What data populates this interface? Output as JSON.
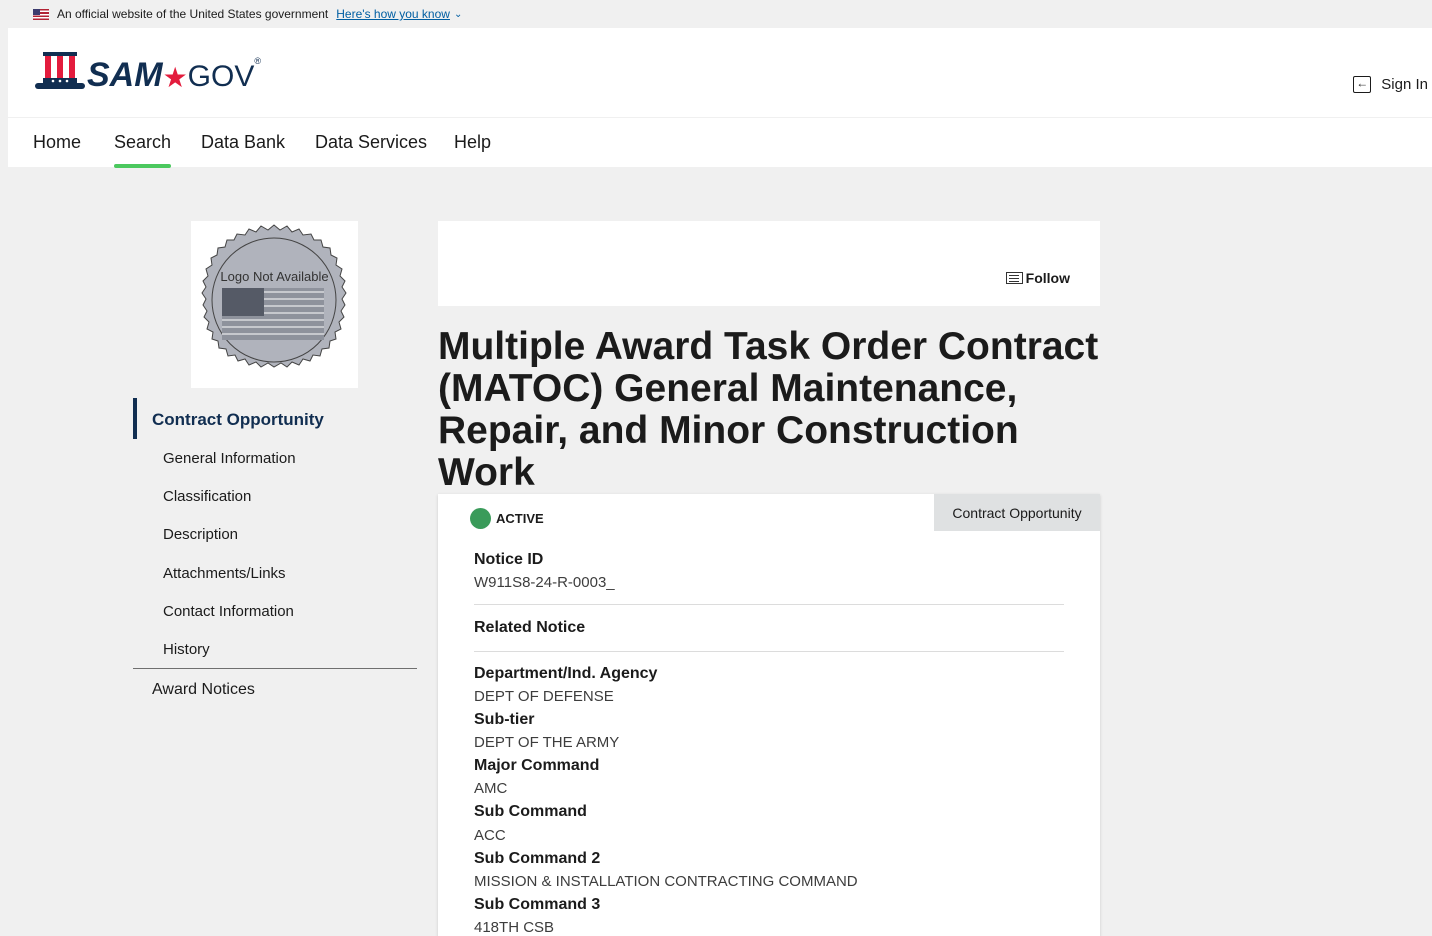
{
  "gov_banner": {
    "text": "An official website of the United States government",
    "link": "Here's how you know"
  },
  "header": {
    "logo_sam": "SAM",
    "logo_dot": "★",
    "logo_gov": "GOV",
    "logo_reg": "®",
    "sign_in": "Sign In"
  },
  "nav": {
    "items": [
      {
        "label": "Home"
      },
      {
        "label": "Search",
        "active": true
      },
      {
        "label": "Data Bank"
      },
      {
        "label": "Data Services"
      },
      {
        "label": "Help"
      }
    ]
  },
  "logo_card": {
    "text": "Logo Not Available"
  },
  "sidenav": {
    "main": "Contract Opportunity",
    "sub": [
      "General Information",
      "Classification",
      "Description",
      "Attachments/Links",
      "Contact Information",
      "History"
    ],
    "award": "Award Notices"
  },
  "follow_label": "Follow",
  "title": "Multiple Award Task Order Contract (MATOC) General Maintenance, Repair, and Minor Construction Work",
  "card": {
    "status": "ACTIVE",
    "status_color": "#3a9b5a",
    "type_tab": "Contract Opportunity",
    "notice_id_label": "Notice ID",
    "notice_id": "W911S8-24-R-0003_",
    "related_label": "Related Notice",
    "fields": [
      {
        "label": "Department/Ind. Agency",
        "value": "DEPT OF DEFENSE"
      },
      {
        "label": "Sub-tier",
        "value": "DEPT OF THE ARMY"
      },
      {
        "label": "Major Command",
        "value": "AMC"
      },
      {
        "label": "Sub Command",
        "value": "ACC"
      },
      {
        "label": "Sub Command 2",
        "value": "MISSION & INSTALLATION CONTRACTING COMMAND"
      },
      {
        "label": "Sub Command 3",
        "value": "418TH CSB"
      }
    ]
  }
}
